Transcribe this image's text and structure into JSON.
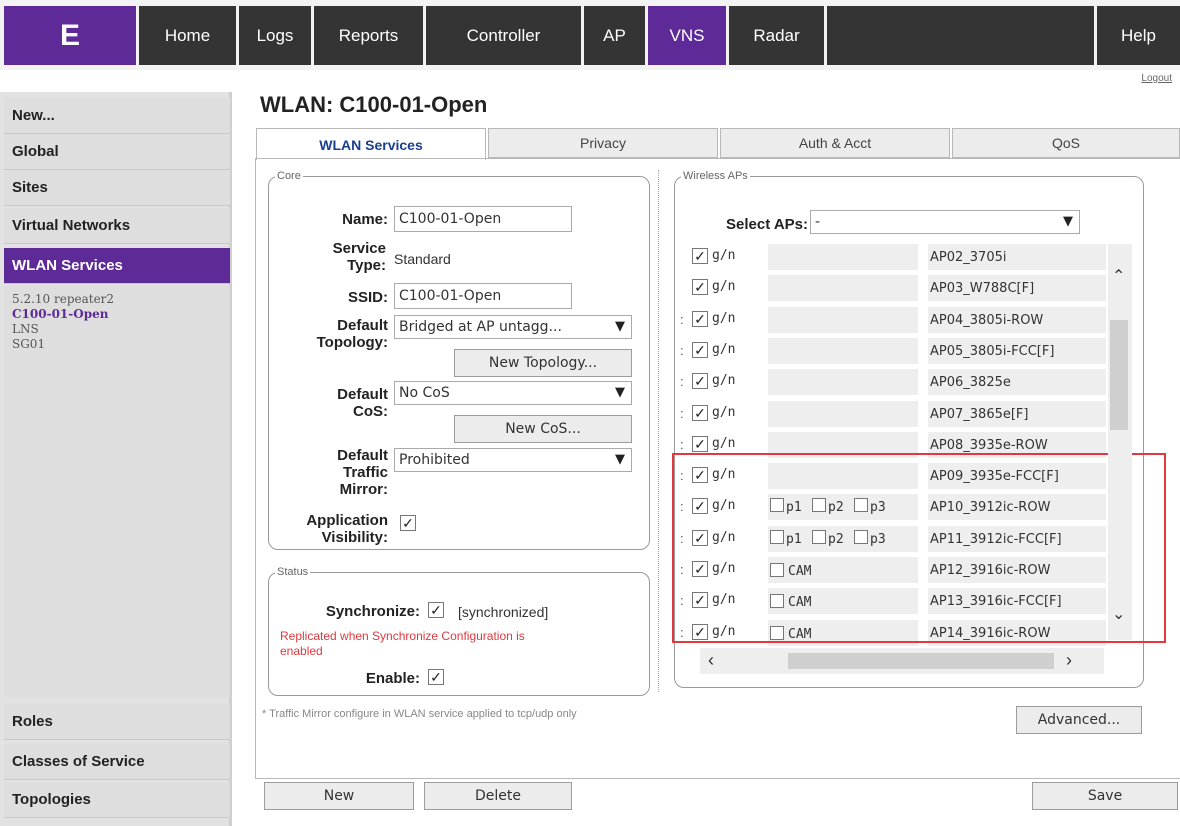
{
  "nav": {
    "logo_glyph": "E",
    "items": [
      "Home",
      "Logs",
      "Reports",
      "Controller",
      "AP",
      "VNS",
      "Radar",
      "Help"
    ],
    "active": "VNS",
    "logout": "Logout"
  },
  "sidebar": {
    "items_top": [
      "New...",
      "Global",
      "Sites",
      "Virtual Networks",
      "WLAN Services"
    ],
    "active": "WLAN Services",
    "sub_items": [
      "5.2.10 repeater2",
      "C100-01-Open",
      "LNS",
      "SG01"
    ],
    "sub_current": "C100-01-Open",
    "items_bottom": [
      "Roles",
      "Classes of Service",
      "Topologies"
    ]
  },
  "page": {
    "title": "WLAN: C100-01-Open",
    "tabs": [
      "WLAN Services",
      "Privacy",
      "Auth & Acct",
      "QoS"
    ],
    "active_tab": "WLAN Services"
  },
  "core": {
    "legend": "Core",
    "name_label": "Name:",
    "name_value": "C100-01-Open",
    "service_type_label_1": "Service",
    "service_type_label_2": "Type:",
    "service_type_value": "Standard",
    "ssid_label": "SSID:",
    "ssid_value": "C100-01-Open",
    "topology_label_1": "Default",
    "topology_label_2": "Topology:",
    "topology_value": "Bridged at AP untagg...",
    "new_topology_button": "New Topology...",
    "cos_label_1": "Default",
    "cos_label_2": "CoS:",
    "cos_value": "No CoS",
    "new_cos_button": "New CoS...",
    "mirror_label_1": "Default",
    "mirror_label_2": "Traffic",
    "mirror_label_3": "Mirror:",
    "mirror_value": "Prohibited",
    "app_vis_label_1": "Application",
    "app_vis_label_2": "Visibility:",
    "app_vis_checked": true
  },
  "status": {
    "legend": "Status",
    "sync_label": "Synchronize:",
    "sync_state": "[synchronized]",
    "replicated_note_1": "Replicated when Synchronize Configuration is",
    "replicated_note_2": "enabled",
    "enable_label": "Enable:"
  },
  "footnote": "* Traffic Mirror configure in WLAN service applied to tcp/udp only",
  "wireless_aps": {
    "legend": "Wireless APs",
    "select_label": "Select APs:",
    "select_value": "-",
    "rows": [
      {
        "mode": "g/n",
        "name": "AP02_3705i",
        "options": []
      },
      {
        "mode": "g/n",
        "name": "AP03_W788C[F]",
        "options": []
      },
      {
        "mode": "g/n",
        "name": "AP04_3805i-ROW",
        "options": []
      },
      {
        "mode": "g/n",
        "name": "AP05_3805i-FCC[F]",
        "options": []
      },
      {
        "mode": "g/n",
        "name": "AP06_3825e",
        "options": []
      },
      {
        "mode": "g/n",
        "name": "AP07_3865e[F]",
        "options": []
      },
      {
        "mode": "g/n",
        "name": "AP08_3935e-ROW",
        "options": []
      },
      {
        "mode": "g/n",
        "name": "AP09_3935e-FCC[F]",
        "options": []
      },
      {
        "mode": "g/n",
        "name": "AP10_3912ic-ROW",
        "options": [
          "p1",
          "p2",
          "p3"
        ]
      },
      {
        "mode": "g/n",
        "name": "AP11_3912ic-FCC[F]",
        "options": [
          "p1",
          "p2",
          "p3"
        ]
      },
      {
        "mode": "g/n",
        "name": "AP12_3916ic-ROW",
        "options": [
          "CAM"
        ]
      },
      {
        "mode": "g/n",
        "name": "AP13_3916ic-FCC[F]",
        "options": [
          "CAM"
        ]
      },
      {
        "mode": "g/n",
        "name": "AP14_3916ic-ROW",
        "options": [
          "CAM"
        ]
      }
    ],
    "highlight_color": "#e0393e",
    "advanced_button": "Advanced..."
  },
  "bottom_buttons": {
    "new": "New",
    "delete": "Delete",
    "save": "Save"
  },
  "colors": {
    "brand": "#5d2a97",
    "nav_bg": "#343434",
    "warning_text": "#e0393e"
  }
}
